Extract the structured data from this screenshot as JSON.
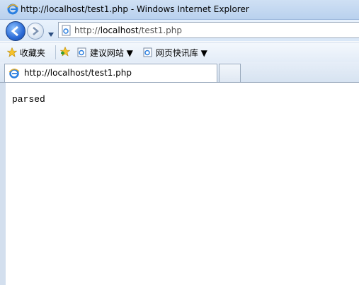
{
  "window": {
    "title": "http://localhost/test1.php - Windows Internet Explorer"
  },
  "address_bar": {
    "url_prefix": "http://",
    "url_host": "localhost",
    "url_path": "/test1.php"
  },
  "favorites_bar": {
    "favorites_label": "收藏夹",
    "items": [
      {
        "label": "建议网站 ▼"
      },
      {
        "label": "网页快讯库 ▼"
      }
    ]
  },
  "tabs": [
    {
      "label": "http://localhost/test1.php"
    }
  ],
  "page": {
    "body_text": "parsed"
  },
  "icons": {
    "ie": "ie-logo-icon",
    "page": "page-icon",
    "star": "star-icon",
    "add_fav": "add-favorite-icon"
  }
}
